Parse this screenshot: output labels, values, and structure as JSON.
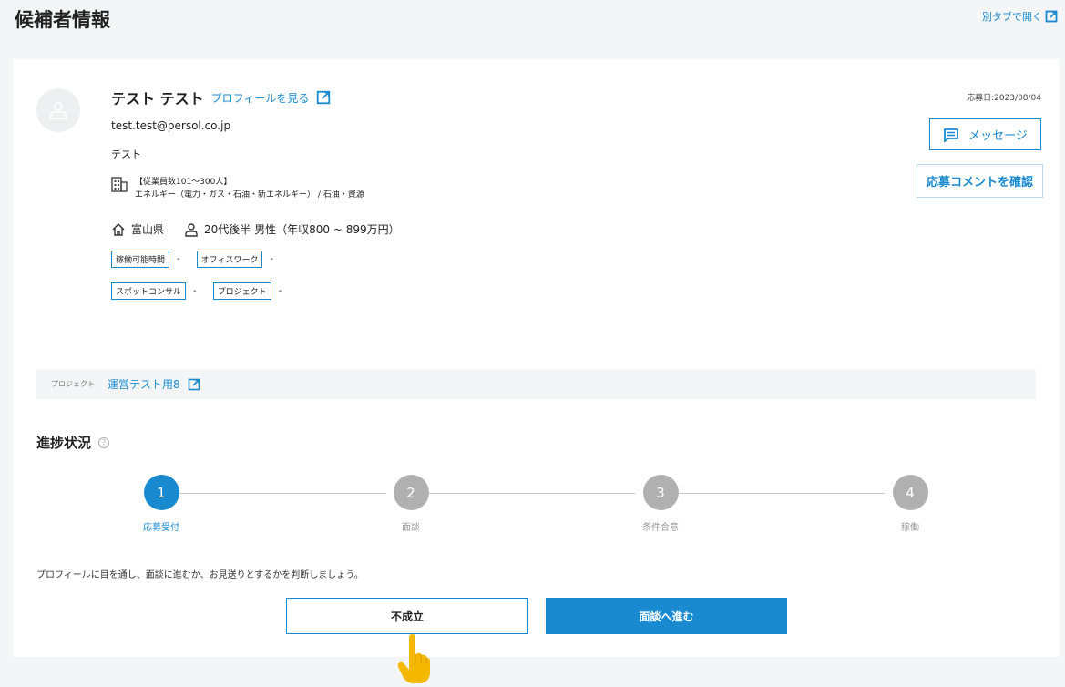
{
  "page": {
    "title": "候補者情報",
    "open_new_tab": "別タブで開く"
  },
  "candidate": {
    "name": "テスト テスト",
    "profile_link": "プロフィールを見る",
    "email": "test.test@persol.co.jp",
    "short_name": "テスト",
    "company_size": "【従業員数101～300人】",
    "industry": "エネルギー（電力・ガス・石油・新エネルギー） / 石油・資源",
    "location": "富山県",
    "demographics": "20代後半 男性（年収800 ~ 899万円）",
    "tags": [
      {
        "label": "稼働可能時間",
        "value": "-"
      },
      {
        "label": "オフィスワーク",
        "value": "-"
      },
      {
        "label": "スポットコンサル",
        "value": "-"
      },
      {
        "label": "プロジェクト",
        "value": "-"
      }
    ],
    "apply_date": "応募日:2023/08/04",
    "message_button": "メッセージ",
    "comment_button": "応募コメントを確認"
  },
  "project": {
    "label": "プロジェクト",
    "name": "運営テスト用8"
  },
  "progress": {
    "title": "進捗状況",
    "help": "?",
    "steps": [
      {
        "number": "1",
        "label": "応募受付",
        "active": true
      },
      {
        "number": "2",
        "label": "面談",
        "active": false
      },
      {
        "number": "3",
        "label": "条件合意",
        "active": false
      },
      {
        "number": "4",
        "label": "稼働",
        "active": false
      }
    ],
    "guidance": "プロフィールに目を通し、面談に進むか、お見送りとするかを判断しましょう。"
  },
  "actions": {
    "reject": "不成立",
    "proceed": "面談へ進む"
  },
  "colors": {
    "accent": "#1a8ad0",
    "pointer": "#f5b800"
  },
  "icons": [
    "external-link-icon",
    "user-icon",
    "building-icon",
    "home-icon",
    "person-icon",
    "message-icon",
    "help-icon",
    "pointer-hand-icon"
  ]
}
